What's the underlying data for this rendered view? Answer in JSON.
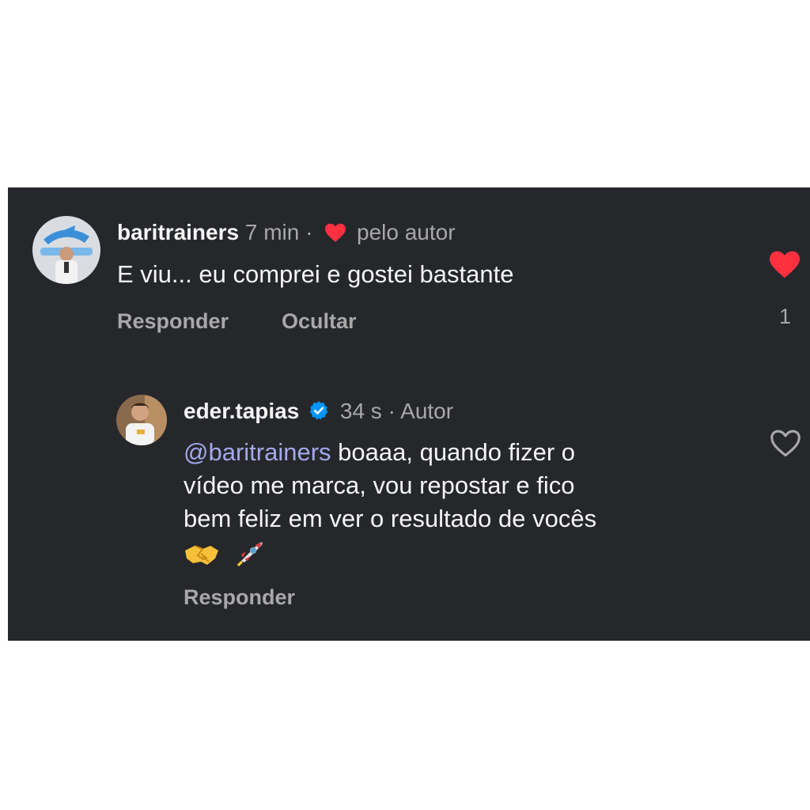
{
  "comment": {
    "username": "baritrainers",
    "time": "7 min",
    "separator": "·",
    "liked_by_author_label": "pelo autor",
    "text": "E viu... eu comprei e gostei bastante",
    "reply_label": "Responder",
    "hide_label": "Ocultar",
    "like_count": "1",
    "liked": true
  },
  "reply": {
    "username": "eder.tapias",
    "verified": true,
    "time": "34 s",
    "separator": "·",
    "author_badge": "Autor",
    "mention": "@baritrainers",
    "text_line1": " boaaa, quando fizer o",
    "text_line2": "vídeo me marca, vou repostar e fico",
    "text_line3": "bem feliz em ver o resultado de vocês",
    "emojis": [
      "handshake-emoji",
      "rocket-emoji"
    ],
    "reply_label": "Responder",
    "liked": false
  },
  "colors": {
    "background": "#25272b",
    "text": "#f5f5f5",
    "secondary_text": "#a8a8a8",
    "mention": "#a3a9ec",
    "like_red": "#ff3040",
    "verified_blue": "#0095f6"
  }
}
